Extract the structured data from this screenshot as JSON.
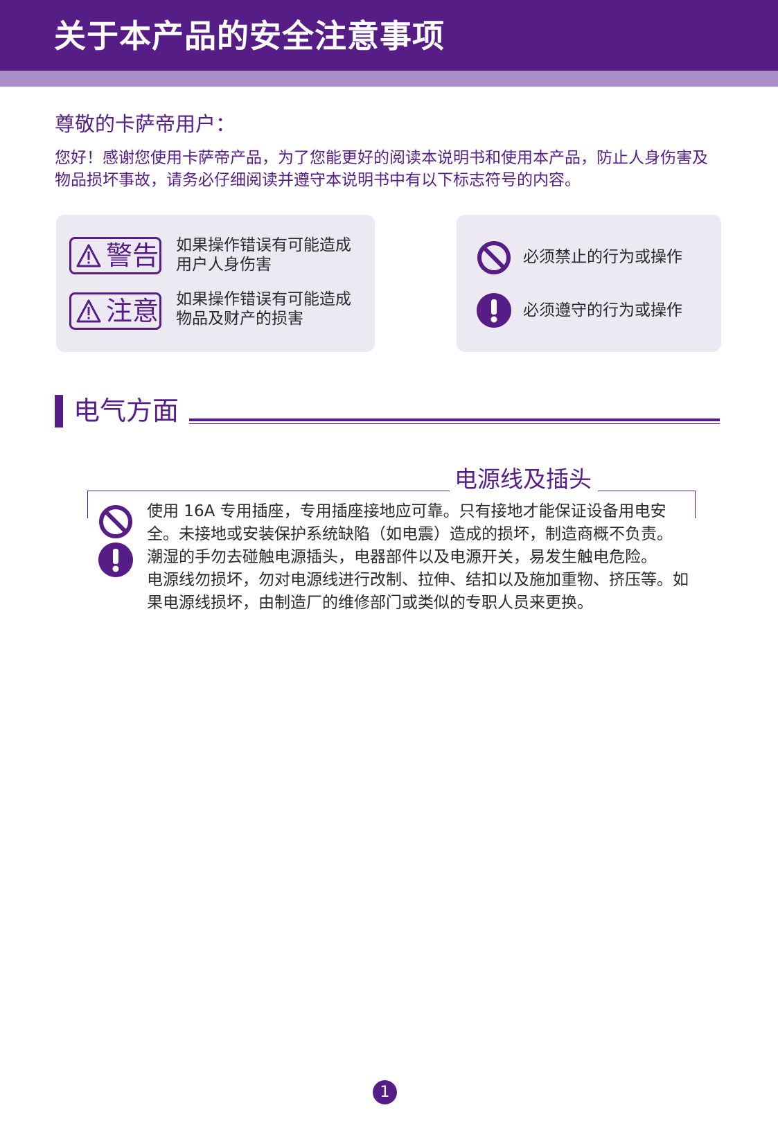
{
  "header": {
    "title": "关于本产品的安全注意事项"
  },
  "greeting": "尊敬的卡萨帝用户：",
  "intro": "您好！感谢您使用卡萨帝产品，为了您能更好的阅读本说明书和使用本产品，防止人身伤害及物品损坏事故，请务必仔细阅读并遵守本说明书中有以下标志符号的内容。",
  "legend_left": [
    {
      "badge": "警告",
      "desc": "如果操作错误有可能造成用户人身伤害"
    },
    {
      "badge": "注意",
      "desc": "如果操作错误有可能造成物品及财产的损害"
    }
  ],
  "legend_right": [
    {
      "icon": "prohibit-icon",
      "label": "必须禁止的行为或操作"
    },
    {
      "icon": "mandatory-icon",
      "label": "必须遵守的行为或操作"
    }
  ],
  "section": {
    "title": "电气方面",
    "subsection_title": "电源线及插头",
    "paragraphs": [
      "使用 16A 专用插座，专用插座接地应可靠。只有接地才能保证设备用电安全。未接地或安装保护系统缺陷（如电震）造成的损坏，制造商概不负责。",
      "潮湿的手勿去碰触电源插头，电器部件以及电源开关，易发生触电危险。",
      "电源线勿损坏，勿对电源线进行改制、拉伸、结扣以及施加重物、挤压等。如果电源线损坏，由制造厂的维修部门或类似的专职人员来更换。"
    ]
  },
  "page_number": "1",
  "colors": {
    "brand_purple": "#561d87",
    "stripe_lavender": "#a98ec9",
    "panel_bg": "#ede9f3"
  }
}
